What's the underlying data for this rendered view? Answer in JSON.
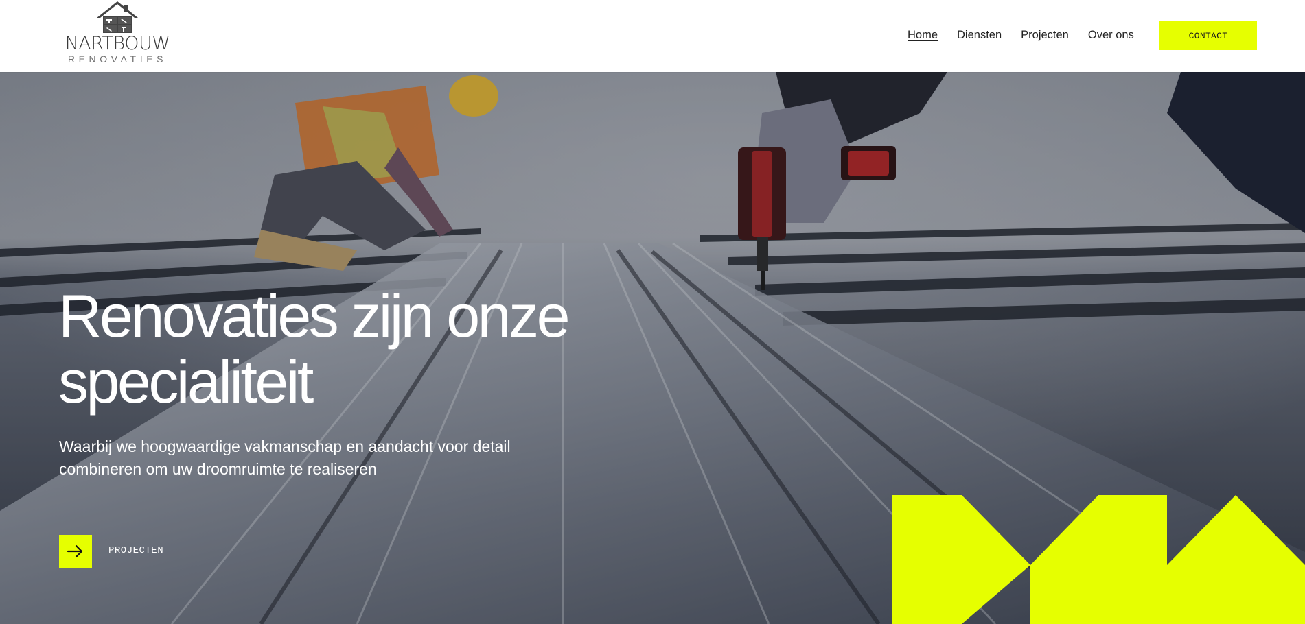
{
  "brand": {
    "name": "NARTBOUW",
    "tagline": "RENOVATIES"
  },
  "nav": {
    "items": [
      {
        "label": "Home",
        "active": true
      },
      {
        "label": "Diensten",
        "active": false
      },
      {
        "label": "Projecten",
        "active": false
      },
      {
        "label": "Over ons",
        "active": false
      }
    ],
    "contact_label": "CONTACT"
  },
  "hero": {
    "title_line1": "Renovaties zijn onze",
    "title_line2": "specialiteit",
    "subtitle_line1": "Waarbij we hoogwaardige vakmanschap en aandacht voor detail",
    "subtitle_line2": "combineren om uw droomruimte te realiseren",
    "cta_label": "PROJECTEN",
    "cta_icon": "arrow-right-icon"
  },
  "colors": {
    "accent": "#e6ff00",
    "header_bg": "#ffffff",
    "text_dark": "#222222",
    "hero_text": "#ffffff"
  },
  "icons": {
    "logo": "house-tools-icon",
    "cta": "arrow-right-icon"
  }
}
